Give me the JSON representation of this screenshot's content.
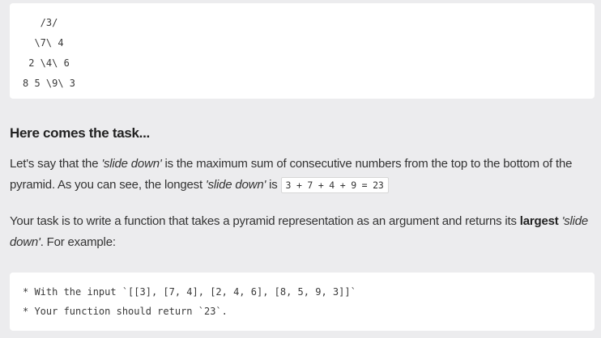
{
  "pyramid": {
    "lines": [
      "   /3/",
      "  \\7\\ 4",
      " 2 \\4\\ 6",
      "8 5 \\9\\ 3"
    ]
  },
  "task": {
    "heading": "Here comes the task...",
    "p1_a": "Let's say that the ",
    "p1_em1": "'slide down'",
    "p1_b": " is the maximum sum of consecutive numbers from the top to the bottom of the pyramid. As you can see, the longest ",
    "p1_em2": "'slide down'",
    "p1_c": " is ",
    "p1_code": "3 + 7 + 4 + 9 = 23",
    "p2_a": "Your task is to write a function that takes a pyramid representation as an argument and returns its ",
    "p2_strong": "largest",
    "p2_space": " ",
    "p2_em": "'slide down'",
    "p2_b": ". For example:"
  },
  "example": {
    "lines": [
      "* With the input `[[3], [7, 4], [2, 4, 6], [8, 5, 9, 3]]`",
      "* Your function should return `23`."
    ]
  }
}
